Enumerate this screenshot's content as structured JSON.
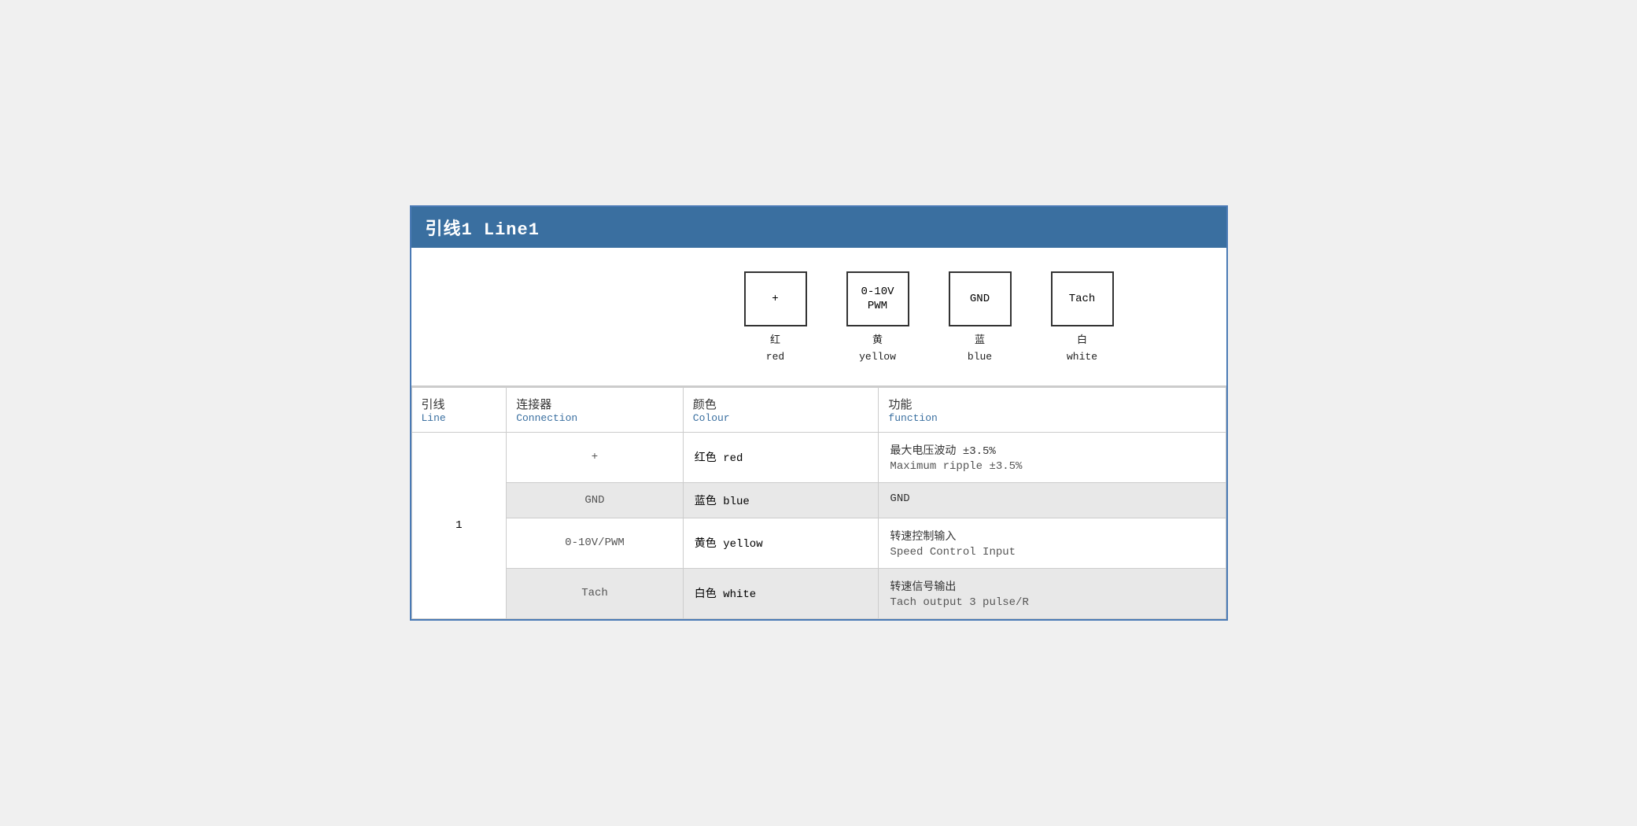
{
  "title": "引线1 Line1",
  "diagram": {
    "connectors": [
      {
        "id": "plus",
        "label": "+",
        "zh": "红",
        "en": "red"
      },
      {
        "id": "pwm",
        "label": "0-10V\nPWM",
        "zh": "黄",
        "en": "yellow"
      },
      {
        "id": "gnd",
        "label": "GND",
        "zh": "蓝",
        "en": "blue"
      },
      {
        "id": "tach",
        "label": "Tach",
        "zh": "白",
        "en": "white"
      }
    ]
  },
  "table": {
    "headers": {
      "line_zh": "引线",
      "line_en": "Line",
      "conn_zh": "连接器",
      "conn_en": "Connection",
      "color_zh": "颜色",
      "color_en": "Colour",
      "func_zh": "功能",
      "func_en": "function"
    },
    "rows": [
      {
        "line": "1",
        "conn": "+",
        "color_zh": "红色 red",
        "func_zh": "最大电压波动 ±3.5%",
        "func_en": "Maximum ripple ±3.5%",
        "shaded": false
      },
      {
        "line": "",
        "conn": "GND",
        "color_zh": "蓝色 blue",
        "func_zh": "GND",
        "func_en": "",
        "shaded": true
      },
      {
        "line": "",
        "conn": "0-10V/PWM",
        "color_zh": "黄色 yellow",
        "func_zh": "转速控制输入",
        "func_en": "Speed Control Input",
        "shaded": false
      },
      {
        "line": "",
        "conn": "Tach",
        "color_zh": "白色 white",
        "func_zh": "转速信号输出",
        "func_en": "Tach output 3 pulse/R",
        "shaded": true
      }
    ]
  }
}
